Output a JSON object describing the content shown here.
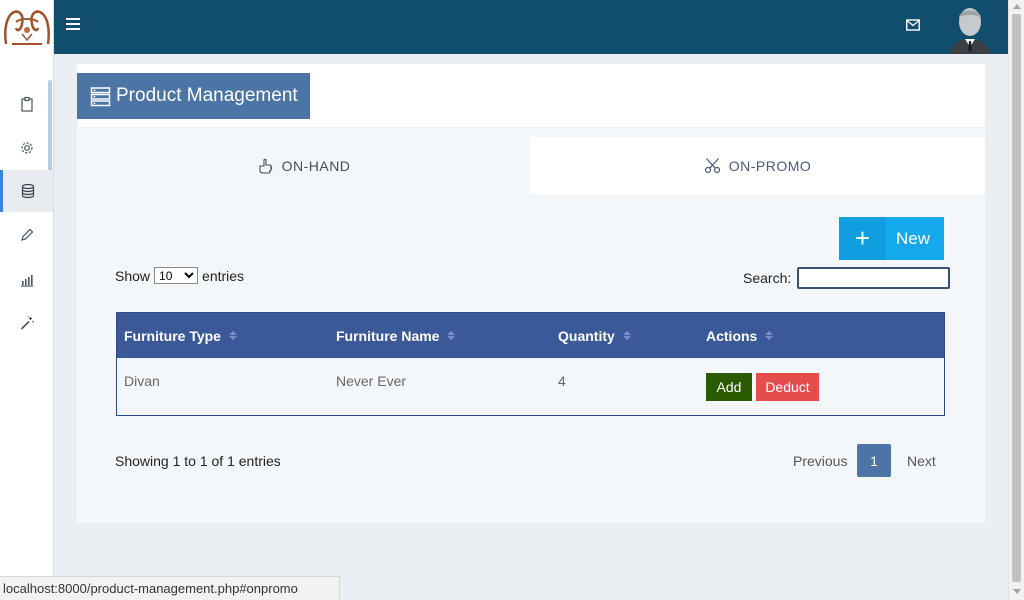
{
  "colors": {
    "topbar": "#114d6d",
    "title_bg": "#4c74a4",
    "table_head": "#3b5998",
    "new_button": "#14a8ec",
    "add_button": "#2a5b00",
    "deduct_button": "#e54d4d",
    "active_indicator": "#3a84e0"
  },
  "sidebar": {
    "logo": "furniture-logo",
    "items": [
      {
        "icon": "clipboard-icon",
        "active": false
      },
      {
        "icon": "gear-icon",
        "active": false
      },
      {
        "icon": "database-icon",
        "active": true
      },
      {
        "icon": "pencil-icon",
        "active": false
      },
      {
        "icon": "bar-chart-icon",
        "active": false
      },
      {
        "icon": "magic-wand-icon",
        "active": false
      }
    ]
  },
  "topbar": {
    "menu_icon": "hamburger-icon",
    "mail_icon": "envelope-icon",
    "avatar": "user-avatar"
  },
  "page": {
    "title": "Product Management",
    "title_icon": "server-list-icon",
    "tabs": [
      {
        "label": "ON-HAND",
        "icon": "hand-icon",
        "active": true
      },
      {
        "label": "ON-PROMO",
        "icon": "scissors-icon",
        "active": false
      }
    ],
    "new_button": {
      "icon": "+",
      "label": "New"
    },
    "length": {
      "show": "Show",
      "value": "10",
      "entries": "entries"
    },
    "search": {
      "label": "Search:",
      "value": ""
    }
  },
  "table": {
    "columns": [
      "Furniture Type",
      "Furniture Name",
      "Quantity",
      "Actions"
    ],
    "rows": [
      {
        "type": "Divan",
        "name": "Never Ever",
        "quantity": "4",
        "add": "Add",
        "deduct": "Deduct"
      }
    ]
  },
  "footer": {
    "info": "Showing 1 to 1 of 1 entries",
    "previous": "Previous",
    "current_page": "1",
    "next": "Next"
  },
  "status_url": "localhost:8000/product-management.php#onpromo"
}
